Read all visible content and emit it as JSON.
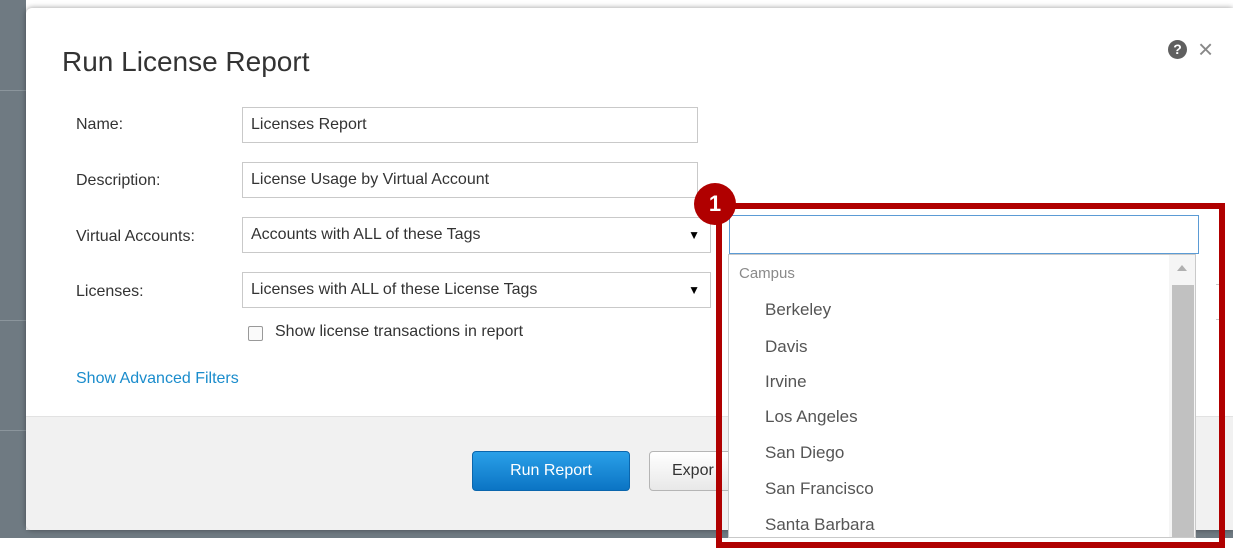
{
  "dialog": {
    "title": "Run License Report",
    "help_icon": "?",
    "close_icon": "×"
  },
  "form": {
    "name_label": "Name:",
    "name_value": "Licenses Report",
    "description_label": "Description:",
    "description_value": "License Usage by Virtual Account",
    "virtual_accounts_label": "Virtual Accounts:",
    "virtual_accounts_value": "Accounts with ALL of these Tags",
    "licenses_label": "Licenses:",
    "licenses_value": "Licenses with ALL of these License Tags",
    "checkbox_label": "Show license transactions in report",
    "advanced_link": "Show Advanced Filters",
    "select_arrow": "▼"
  },
  "buttons": {
    "run": "Run Report",
    "export": "Expor"
  },
  "dropdown": {
    "search_value": "",
    "group": "Campus",
    "items": [
      "Berkeley",
      "Davis",
      "Irvine",
      "Los Angeles",
      "San Diego",
      "San Francisco",
      "Santa Barbara"
    ]
  },
  "annotation": {
    "badge": "1",
    "color": "#b00000"
  },
  "colors": {
    "primary_button": "#0b74c4",
    "link": "#1a8ccc",
    "focus_border": "#5b9bd5"
  },
  "icons": [
    "help-icon",
    "close-icon",
    "chevron-down-icon",
    "scroll-up-icon"
  ]
}
